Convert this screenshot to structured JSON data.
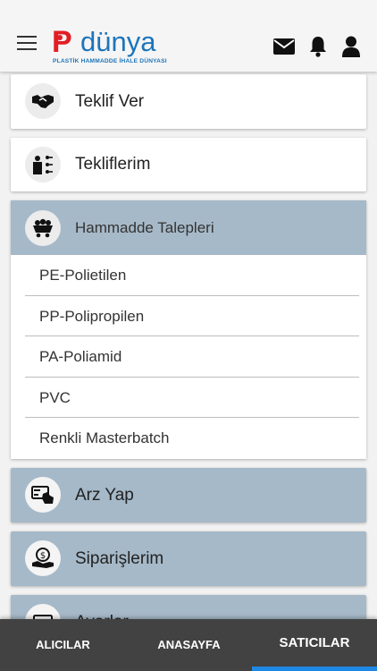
{
  "header": {
    "logo_brand": "Pdünya",
    "logo_text": "dünya",
    "logo_tagline": "PLASTİK HAMMADDE İHALE DÜNYASI",
    "icons": [
      "menu-icon",
      "mail-icon",
      "bell-icon",
      "user-icon"
    ]
  },
  "menu": {
    "items": [
      {
        "label": "Teklif Ver",
        "icon": "handshake-icon"
      },
      {
        "label": "Tekliflerim",
        "icon": "presenter-icon"
      },
      {
        "label": "Hammadde Talepleri",
        "icon": "cart-icon",
        "subitems": [
          "PE-Polietilen",
          "PP-Polipropilen",
          "PA-Poliamid",
          "PVC",
          "Renkli Masterbatch"
        ]
      },
      {
        "label": "Arz Yap",
        "icon": "card-hand-icon"
      },
      {
        "label": "Siparişlerim",
        "icon": "money-hand-icon"
      },
      {
        "label": "Ayarlar",
        "icon": "settings-card-icon"
      }
    ]
  },
  "tabs": [
    {
      "label": "ALICILAR"
    },
    {
      "label": "ANASAYFA"
    },
    {
      "label": "SATICILAR",
      "active": true
    }
  ],
  "colors": {
    "accent_red": "#e21e25",
    "accent_blue": "#1d75bb",
    "section_bg": "#a6b9c8",
    "tabbar_bg": "#424242",
    "tab_indicator": "#1e88e5"
  }
}
